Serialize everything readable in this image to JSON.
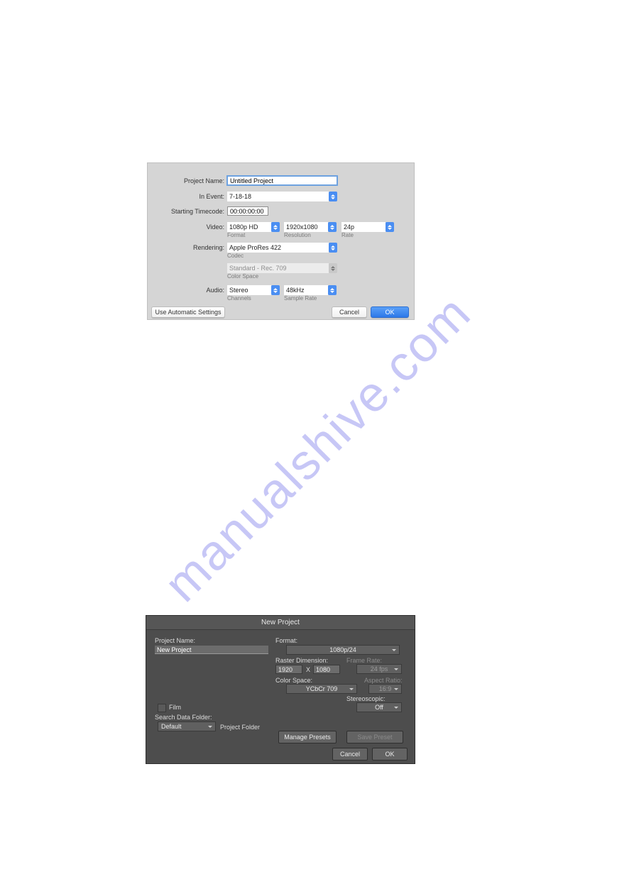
{
  "watermark": "manualshive.com",
  "dialog1": {
    "labels": {
      "project_name": "Project Name:",
      "in_event": "In Event:",
      "starting_tc": "Starting Timecode:",
      "video": "Video:",
      "rendering": "Rendering:",
      "audio": "Audio:"
    },
    "sublabels": {
      "format": "Format",
      "resolution": "Resolution",
      "rate": "Rate",
      "codec": "Codec",
      "color_space": "Color Space",
      "channels": "Channels",
      "sample_rate": "Sample Rate"
    },
    "values": {
      "project_name": "Untitled Project",
      "in_event": "7-18-18",
      "starting_tc": "00:00:00:00",
      "video_format": "1080p HD",
      "video_resolution": "1920x1080",
      "video_rate": "24p",
      "rendering_codec": "Apple ProRes 422",
      "rendering_colorspace": "Standard - Rec. 709",
      "audio_channels": "Stereo",
      "audio_sample_rate": "48kHz"
    },
    "buttons": {
      "auto": "Use Automatic Settings",
      "cancel": "Cancel",
      "ok": "OK"
    }
  },
  "dialog2": {
    "title": "New Project",
    "labels": {
      "project_name": "Project Name:",
      "format": "Format:",
      "raster_dim": "Raster Dimension:",
      "frame_rate": "Frame Rate:",
      "color_space": "Color Space:",
      "aspect_ratio": "Aspect Ratio:",
      "stereoscopic": "Stereoscopic:",
      "film": "Film",
      "search_data_folder": "Search Data Folder:",
      "project_folder": "Project Folder"
    },
    "values": {
      "project_name": "New Project",
      "format": "1080p/24",
      "raster_w": "1920",
      "raster_x": "X",
      "raster_h": "1080",
      "frame_rate": "24 fps",
      "color_space": "YCbCr 709",
      "aspect_ratio": "16:9",
      "stereoscopic": "Off",
      "search_data_folder": "Default"
    },
    "buttons": {
      "manage_presets": "Manage Presets",
      "save_preset": "Save Preset",
      "cancel": "Cancel",
      "ok": "OK"
    }
  }
}
